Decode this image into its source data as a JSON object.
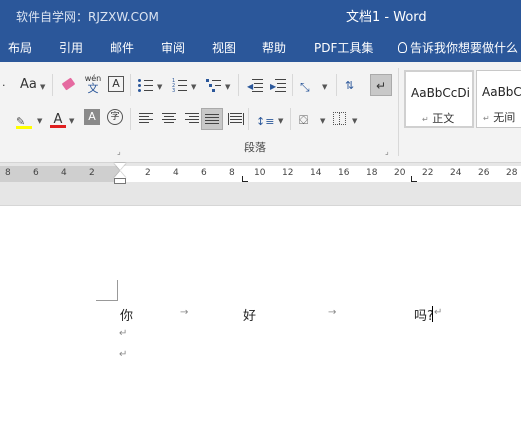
{
  "titlebar": {
    "watermark": "软件自学网：RJZXW.COM",
    "doc_title": "文档1  -  Word"
  },
  "tabs": [
    {
      "label": "布局"
    },
    {
      "label": "引用"
    },
    {
      "label": "邮件"
    },
    {
      "label": "审阅"
    },
    {
      "label": "视图"
    },
    {
      "label": "帮助"
    },
    {
      "label": "PDF工具集"
    }
  ],
  "tell_me": {
    "label": "告诉我你想要做什么"
  },
  "ribbon": {
    "font_size_label": "Aa",
    "phonetic_label": "wén",
    "phonetic_char": "文",
    "char_border": "A",
    "font_color_a": "A",
    "shade_a": "A",
    "enclose_char": "字",
    "group_paragraph": "段落"
  },
  "styles": [
    {
      "sample": "AaBbCcDi",
      "name": "正文"
    },
    {
      "sample": "AaBbC",
      "name": "无间"
    }
  ],
  "ruler": {
    "left_ticks": [
      "8",
      "6",
      "4",
      "2"
    ],
    "right_ticks": [
      "2",
      "4",
      "6",
      "8",
      "10",
      "12",
      "14",
      "16",
      "18",
      "20",
      "22",
      "24",
      "26",
      "28"
    ]
  },
  "document": {
    "line1": {
      "w1": "你",
      "w2": "好",
      "w3": "吗?"
    },
    "tab_arrow": "→",
    "para_mark": "↵"
  },
  "colors": {
    "brand": "#2b579a",
    "font_red": "#e02020",
    "highlight_yellow": "#ffff00"
  }
}
